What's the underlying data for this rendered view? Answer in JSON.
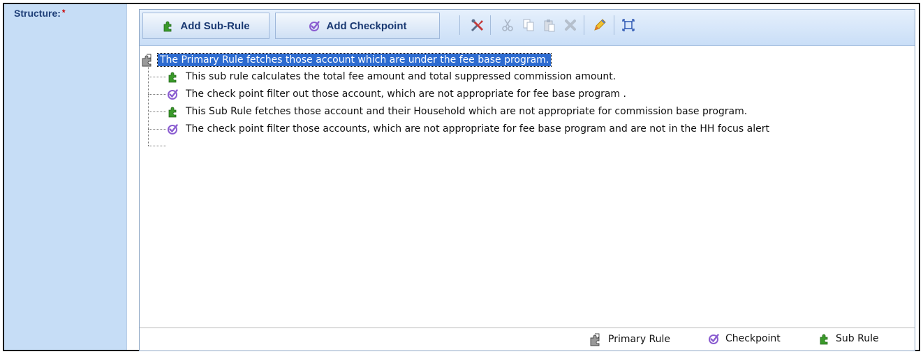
{
  "field": {
    "label": "Structure:",
    "required_mark": "*"
  },
  "toolbar": {
    "add_subrule_label": "Add Sub-Rule",
    "add_checkpoint_label": "Add Checkpoint",
    "icons": [
      "tools-icon",
      "cut-icon",
      "copy-icon",
      "paste-icon",
      "delete-icon",
      "edit-icon",
      "expand-icon"
    ]
  },
  "tree": {
    "root": {
      "type": "primary-rule",
      "text": "The Primary Rule fetches those account which are under the fee base program."
    },
    "children": [
      {
        "type": "sub-rule",
        "text": "This sub rule calculates the  total fee amount and total suppressed commission amount."
      },
      {
        "type": "checkpoint",
        "text": "The check point filter out those account, which are not appropriate for fee base program ."
      },
      {
        "type": "sub-rule",
        "text": "This Sub Rule fetches those account and their Household which are not appropriate for commission base program."
      },
      {
        "type": "checkpoint",
        "text": "The check point filter those accounts, which are not appropriate for fee base program and are not in the HH focus alert"
      }
    ]
  },
  "legend": {
    "primary_rule": "Primary Rule",
    "checkpoint": "Checkpoint",
    "sub_rule": "Sub Rule"
  },
  "colors": {
    "selection": "#2d6bd0",
    "subrule_green": "#3a9a2a",
    "checkpoint_purple": "#8a5cd0",
    "label_bg": "#c6ddf6"
  }
}
